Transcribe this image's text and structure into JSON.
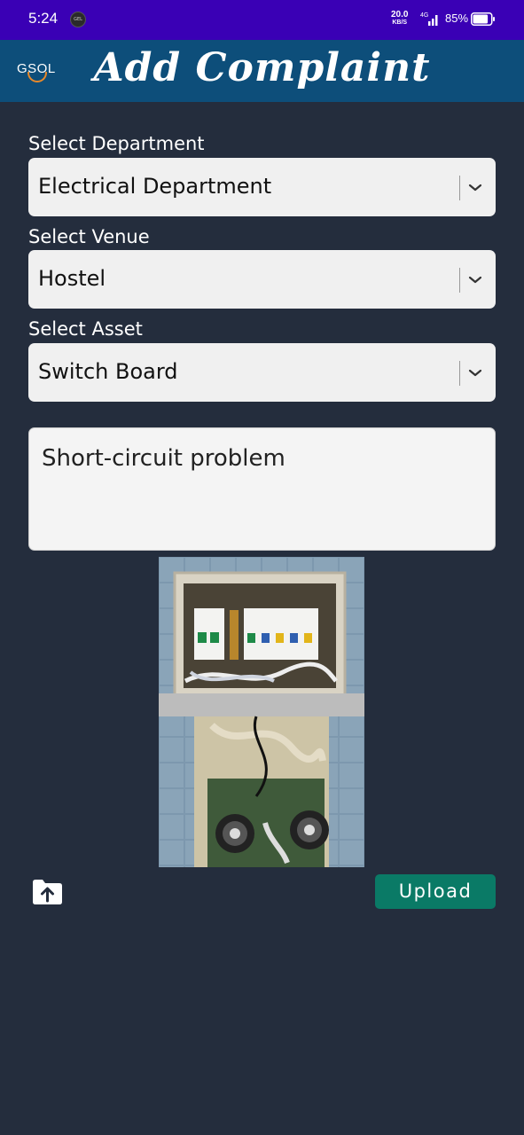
{
  "status_bar": {
    "time": "5:24",
    "notification_label": "GEL",
    "net_speed_value": "20.0",
    "net_speed_unit": "KB/S",
    "network_type": "4G",
    "battery_percent": "85%",
    "battery_level": 0.85
  },
  "app_bar": {
    "logo_text": "GSOL",
    "title": "Add Complaint",
    "color": "#0d4e7a"
  },
  "form": {
    "department": {
      "label": "Select Department",
      "selected": "Electrical Department"
    },
    "venue": {
      "label": "Select Venue",
      "selected": "Hostel"
    },
    "asset": {
      "label": "Select Asset",
      "selected": "Switch Board"
    },
    "description": {
      "value": "Short-circuit problem"
    },
    "attachment": {
      "icon": "folder-upload-icon"
    },
    "upload_button": {
      "label": "Upload",
      "color": "#0a7a66"
    }
  },
  "colors": {
    "status_bar": "#3a00b5",
    "background": "#242d3d"
  }
}
